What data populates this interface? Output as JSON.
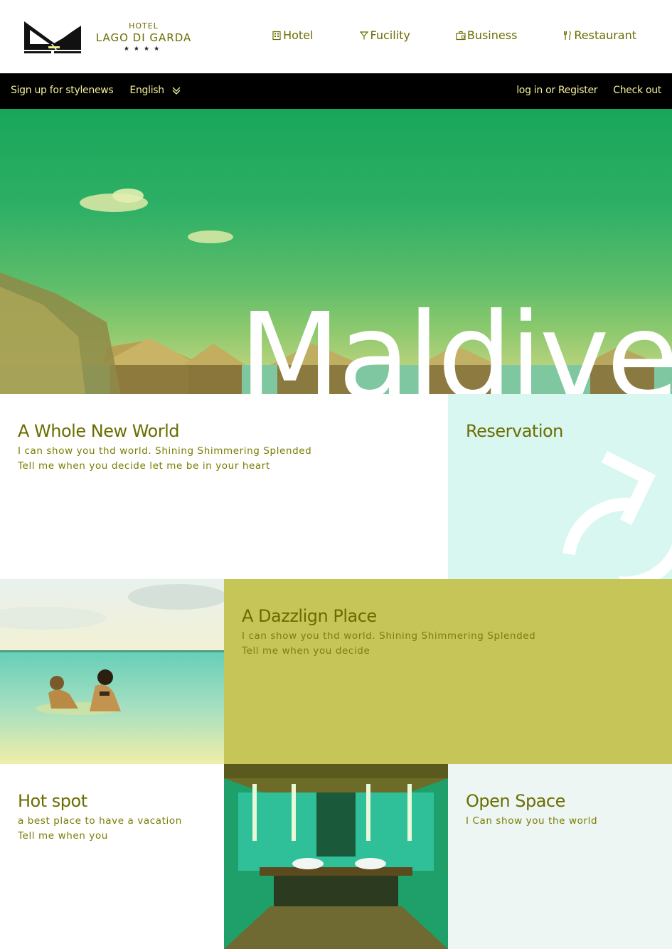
{
  "brand": {
    "line1": "HOTEL",
    "line2": "LAGO DI GARDA",
    "stars": "★★★★"
  },
  "nav": {
    "items": [
      {
        "label": "Hotel",
        "icon": "building-icon"
      },
      {
        "label": "Fucility",
        "icon": "cocktail-glass-icon"
      },
      {
        "label": "Business",
        "icon": "briefcase-icon"
      },
      {
        "label": "Restaurant",
        "icon": "fork-knife-icon"
      }
    ]
  },
  "topbar": {
    "signup": "Sign up for stylenews",
    "language": "English",
    "login": "log in or Register",
    "checkout": "Check out"
  },
  "hero": {
    "title": "Maldives"
  },
  "cards": {
    "whole": {
      "title": "A Whole New World",
      "line1": "I can show you thd world. Shining Shimmering Splended",
      "line2": "Tell me when you decide let me be in your heart"
    },
    "reservation": {
      "title": "Reservation",
      "icon": "refresh-arrow-icon"
    },
    "dazzle": {
      "title": "A Dazzlign Place",
      "line1": "I can show you thd world. Shining Shimmering Splended",
      "line2": "Tell me when you decide"
    },
    "hotspot": {
      "title": "Hot spot",
      "line1": "a best place to have a vacation",
      "line2": "Tell me when you"
    },
    "open": {
      "title": "Open Space",
      "line1": "I Can show you the world"
    }
  },
  "colors": {
    "accent_text": "#6b6d00",
    "topbar_bg": "#000000",
    "topbar_text": "#f3ef9a",
    "reservation_bg": "#d8f7f1",
    "dazzle_bg": "#c6c557",
    "open_bg": "#eef6f4"
  }
}
